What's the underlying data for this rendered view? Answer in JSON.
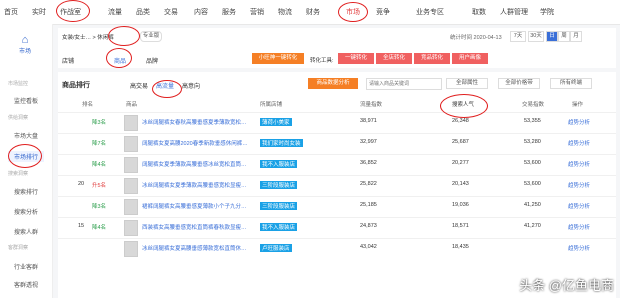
{
  "nav": [
    "首页",
    "实时",
    "作战室",
    "流量",
    "品类",
    "交易",
    "内容",
    "服务",
    "营销",
    "物流",
    "财务",
    "市场",
    "竞争",
    "业务专区",
    "取数",
    "人群管理",
    "学院"
  ],
  "sidebar": {
    "title": "市场",
    "items": [
      {
        "type": "sec",
        "label": "市场监控"
      },
      {
        "type": "item",
        "label": "监控看板"
      },
      {
        "type": "sec",
        "label": "供给洞察"
      },
      {
        "type": "item",
        "label": "市场大盘"
      },
      {
        "type": "item",
        "label": "市场排行",
        "active": true
      },
      {
        "type": "sec",
        "label": "搜索洞察"
      },
      {
        "type": "item",
        "label": "搜索排行"
      },
      {
        "type": "item",
        "label": "搜索分析"
      },
      {
        "type": "item",
        "label": "搜索人群"
      },
      {
        "type": "sec",
        "label": "客群洞察"
      },
      {
        "type": "item",
        "label": "行业客群"
      },
      {
        "type": "item",
        "label": "客群透视"
      }
    ]
  },
  "filter": {
    "category": "女装/女士… > 休闲裤",
    "mode": "专业版",
    "date": "统计时间 2020-04-13",
    "ranges": [
      "7天",
      "30天",
      "日",
      "周",
      "月"
    ],
    "tab_label_1": "店铺",
    "tab_shop": "商品",
    "tab_brand": "品牌",
    "promo": "小旺神一键转化",
    "convert_tool": "转化工具:",
    "convert_btns": [
      "一键转化",
      "全店转化",
      "竞品转化",
      "用户画像"
    ]
  },
  "table": {
    "title": "商品排行",
    "tabs": [
      "高交易",
      "高流量",
      "高意向"
    ],
    "search_placeholder": "请输入商品关键词",
    "selects": [
      "全部属性",
      "全部价格带",
      "所有终端"
    ],
    "analysis_btn": "商品数据分析",
    "headers": [
      "排名",
      "商品",
      "所属店铺",
      "流量指数",
      "搜索人气",
      "交易指数",
      "操作"
    ],
    "rows": [
      {
        "rank": "",
        "change": "降3名",
        "title": "冰丝阔腿裤女春秋高腰垂感夏季薄款宽松拖地休闲直筒拖地裤",
        "shop": "薄荷小美家",
        "traffic": "38,971",
        "search": "26,348",
        "trade": "53,355",
        "op": "趋势分析"
      },
      {
        "rank": "",
        "change": "降7名",
        "title": "阔腿裤女夏高腰2020春季新款垂感休闲裤宽松显瘦拖地直筒裤",
        "shop": "我们家时尚女装",
        "traffic": "32,997",
        "search": "25,687",
        "trade": "53,280",
        "op": "趋势分析"
      },
      {
        "rank": "",
        "change": "降4名",
        "title": "阔腿裤女夏季薄款高腰垂感冰丝宽松直筒裤休闲拖地运动裤子",
        "shop": "我不入服装店",
        "traffic": "36,852",
        "search": "20,277",
        "trade": "53,600",
        "op": "趋势分析"
      },
      {
        "rank": "20",
        "change": "升5名",
        "title": "冰丝阔腿裤女夏季薄款高腰垂感宽松显瘦休闲直筒裤九分裤夏装",
        "shop": "三阶段服装店",
        "traffic": "25,822",
        "search": "20,143",
        "trade": "53,600",
        "op": "趋势分析"
      },
      {
        "rank": "",
        "change": "降3名",
        "title": "裙裤阔腿裤女高腰垂感夏薄款小个子九分宽松直筒休闲裤子女夏",
        "shop": "三阶段服装店",
        "traffic": "25,185",
        "search": "19,036",
        "trade": "41,250",
        "op": "趋势分析"
      },
      {
        "rank": "15",
        "change": "降4名",
        "title": "西装裤女高腰垂感宽松直筒裤春秋款显瘦休闲裤黑色西装阔腿裤",
        "shop": "我不入服装店",
        "traffic": "24,873",
        "search": "18,571",
        "trade": "41,270",
        "op": "趋势分析"
      },
      {
        "rank": "",
        "change": "",
        "title": "冰丝阔腿裤女夏高腰垂感薄款宽松直筒休闲运动裤子拖地裤",
        "shop": "卢旺服装店",
        "traffic": "43,042",
        "search": "18,435",
        "trade": "",
        "op": "趋势分析"
      }
    ]
  },
  "watermark": "头条 @亿鱼电商"
}
